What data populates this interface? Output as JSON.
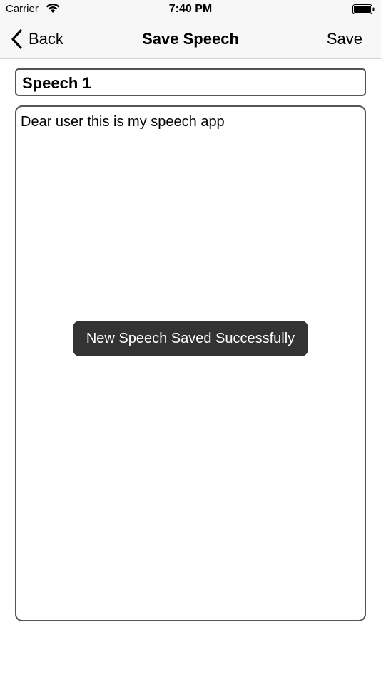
{
  "status_bar": {
    "carrier": "Carrier",
    "time": "7:40 PM",
    "wifi_icon": "wifi-icon",
    "battery_icon": "battery-icon"
  },
  "nav_bar": {
    "back_label": "Back",
    "back_icon": "chevron-left-icon",
    "title": "Save Speech",
    "save_label": "Save"
  },
  "form": {
    "speech_title_value": "Speech 1",
    "speech_body_value": "Dear user this is my speech app"
  },
  "toast": {
    "message": "New Speech Saved Successfully"
  },
  "colors": {
    "nav_background": "#f7f7f7",
    "field_border": "#555555",
    "toast_background": "#333333",
    "toast_text": "#ffffff"
  }
}
